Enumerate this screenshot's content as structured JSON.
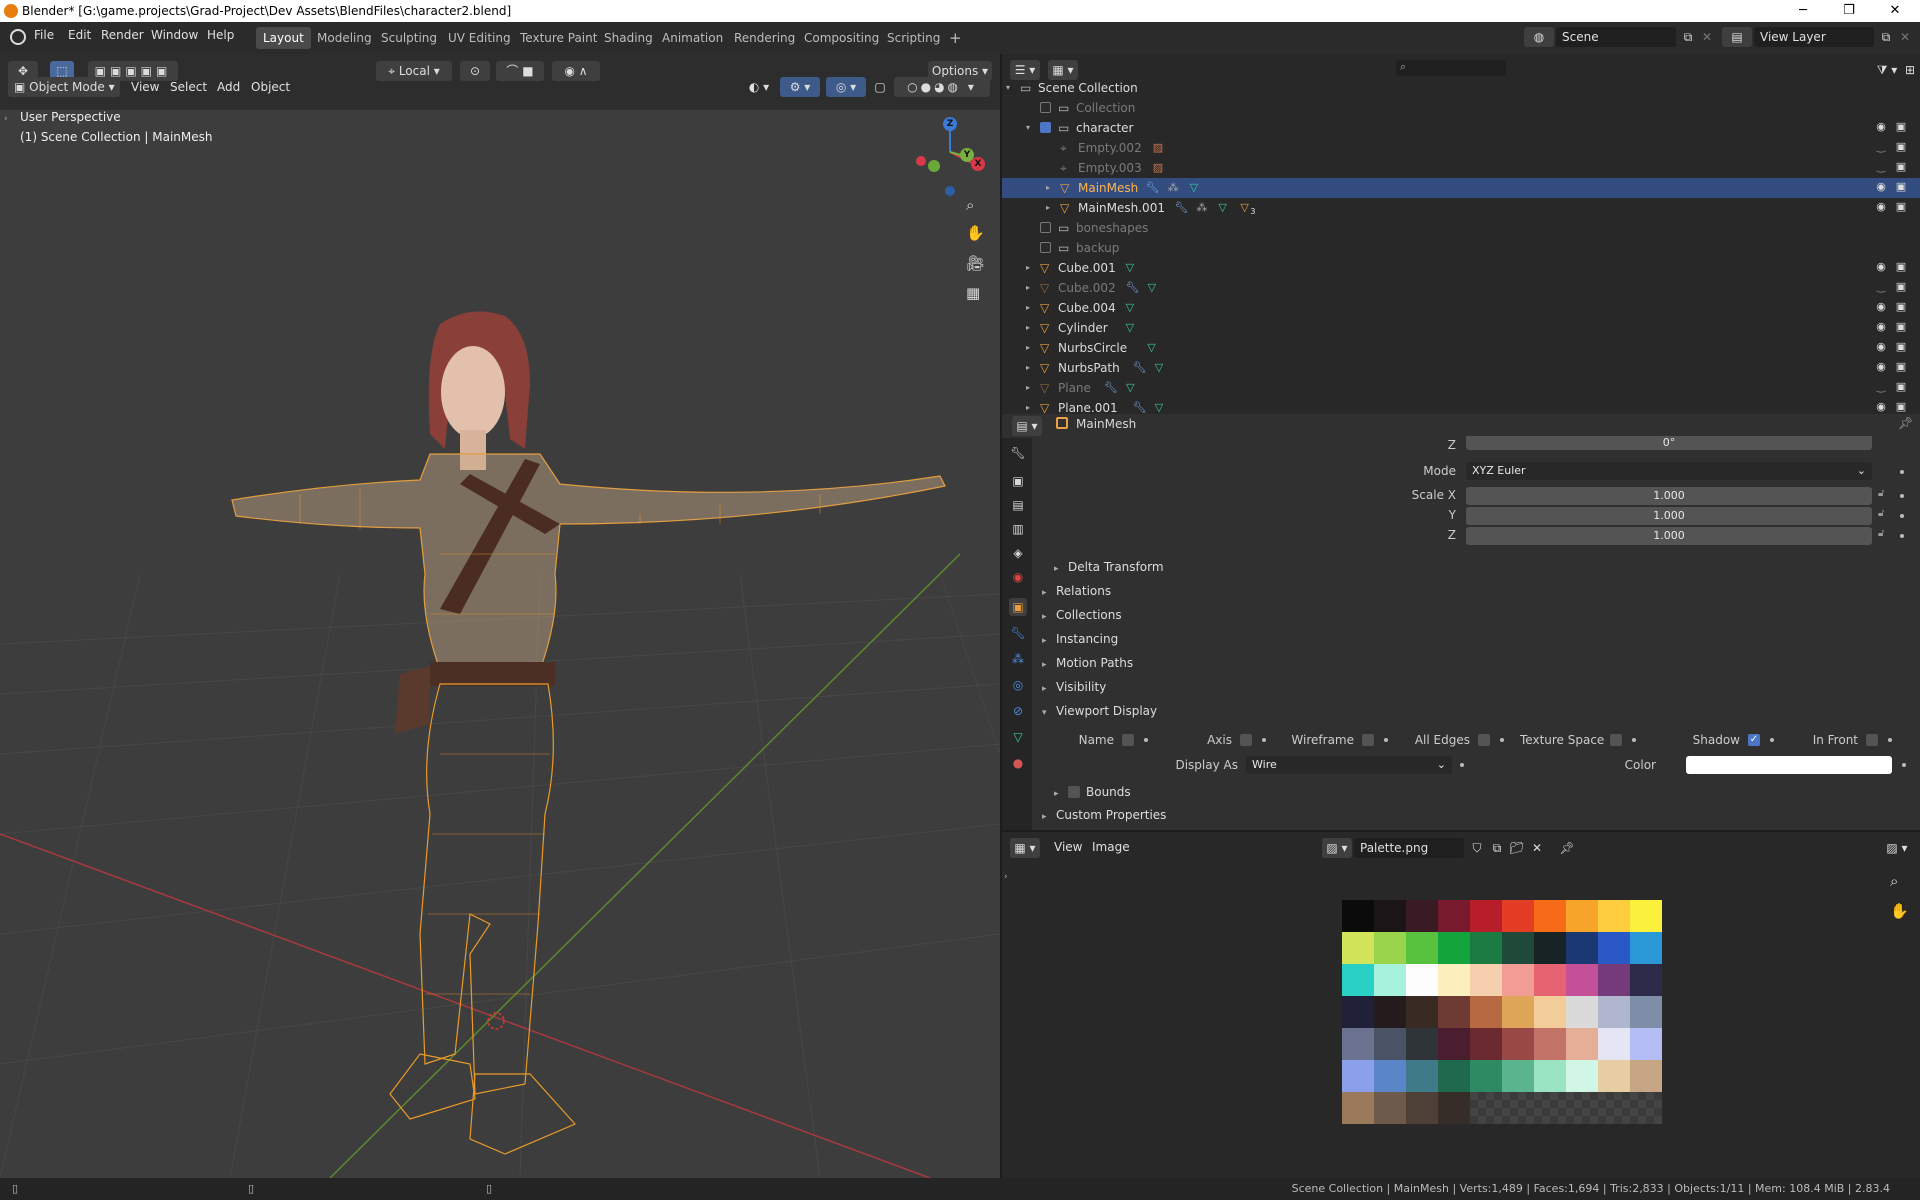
{
  "titlebar": {
    "title": "Blender* [G:\\game.projects\\Grad-Project\\Dev Assets\\BlendFiles\\character2.blend]",
    "minimize": "─",
    "restore": "❐",
    "close": "✕"
  },
  "menus": [
    "File",
    "Edit",
    "Render",
    "Window",
    "Help"
  ],
  "workspaces": [
    "Layout",
    "Modeling",
    "Sculpting",
    "UV Editing",
    "Texture Paint",
    "Shading",
    "Animation",
    "Rendering",
    "Compositing",
    "Scripting"
  ],
  "active_workspace": "Layout",
  "add_workspace": "+",
  "scene": {
    "label": "Scene",
    "view_layer": "View Layer"
  },
  "viewport": {
    "transform_orientation": "Local",
    "options_label": "Options",
    "mode": "Object Mode",
    "menus": [
      "View",
      "Select",
      "Add",
      "Object"
    ],
    "overlay_text": "User Perspective",
    "overlay_sub": "(1) Scene Collection | MainMesh",
    "gizmo": {
      "z": "Z",
      "y": "Y",
      "x": "X"
    }
  },
  "outliner": {
    "search_placeholder": "",
    "rows": [
      {
        "name": "Scene Collection",
        "indent": 0,
        "type": "collection",
        "state": "normal",
        "expanded": true
      },
      {
        "name": "Collection",
        "indent": 1,
        "type": "collection",
        "state": "disabled",
        "check": false
      },
      {
        "name": "character",
        "indent": 1,
        "type": "collection",
        "state": "normal",
        "check": true,
        "expanded": true,
        "vis": true
      },
      {
        "name": "Empty.002",
        "indent": 2,
        "type": "empty",
        "state": "disabled",
        "vis": false
      },
      {
        "name": "Empty.003",
        "indent": 2,
        "type": "empty",
        "state": "disabled",
        "vis": false
      },
      {
        "name": "MainMesh",
        "indent": 2,
        "type": "mesh",
        "state": "selected",
        "vis": true
      },
      {
        "name": "MainMesh.001",
        "indent": 2,
        "type": "mesh",
        "state": "normal",
        "vis": true,
        "badge": "3"
      },
      {
        "name": "boneshapes",
        "indent": 1,
        "type": "collection",
        "state": "disabled",
        "check": false
      },
      {
        "name": "backup",
        "indent": 1,
        "type": "collection",
        "state": "disabled",
        "check": false
      },
      {
        "name": "Cube.001",
        "indent": 1,
        "type": "mesh",
        "state": "normal",
        "vis": true
      },
      {
        "name": "Cube.002",
        "indent": 1,
        "type": "mesh",
        "state": "disabled",
        "vis": false
      },
      {
        "name": "Cube.004",
        "indent": 1,
        "type": "mesh",
        "state": "normal",
        "vis": true
      },
      {
        "name": "Cylinder",
        "indent": 1,
        "type": "mesh",
        "state": "normal",
        "vis": true
      },
      {
        "name": "NurbsCircle",
        "indent": 1,
        "type": "mesh",
        "state": "normal",
        "vis": true
      },
      {
        "name": "NurbsPath",
        "indent": 1,
        "type": "mesh",
        "state": "normal",
        "vis": true
      },
      {
        "name": "Plane",
        "indent": 1,
        "type": "mesh",
        "state": "disabled",
        "vis": false
      },
      {
        "name": "Plane.001",
        "indent": 1,
        "type": "mesh",
        "state": "normal",
        "vis": true
      }
    ]
  },
  "properties": {
    "object_name": "MainMesh",
    "rot_z_label": "Z",
    "rot_z_value": "0°",
    "mode_label": "Mode",
    "mode_value": "XYZ Euler",
    "scale_x_label": "Scale X",
    "scale_x": "1.000",
    "scale_y_label": "Y",
    "scale_y": "1.000",
    "scale_z_label": "Z",
    "scale_z": "1.000",
    "delta_transform": "Delta Transform",
    "sections": [
      "Relations",
      "Collections",
      "Instancing",
      "Motion Paths",
      "Visibility"
    ],
    "viewport_display": "Viewport Display",
    "vd_checks": [
      {
        "label": "Name",
        "on": false
      },
      {
        "label": "Axis",
        "on": false
      },
      {
        "label": "Wireframe",
        "on": false
      },
      {
        "label": "All Edges",
        "on": false
      },
      {
        "label": "Texture Space",
        "on": false
      },
      {
        "label": "Shadow",
        "on": true
      },
      {
        "label": "In Front",
        "on": false
      }
    ],
    "display_as_label": "Display As",
    "display_as_value": "Wire",
    "color_label": "Color",
    "color_value": "#ffffff",
    "bounds_label": "Bounds",
    "custom_properties": "Custom Properties"
  },
  "image_editor": {
    "menus": [
      "View",
      "Image"
    ],
    "image_name": "Palette.png",
    "palette": [
      "#0b0b0b",
      "#1b1518",
      "#3a1a24",
      "#781a2e",
      "#b81e2a",
      "#e33d26",
      "#f56b17",
      "#f6a52a",
      "#fecd3e",
      "#fbf13d",
      "#d2e45a",
      "#9ad44a",
      "#58c13d",
      "#13a43b",
      "#1b7b42",
      "#1f4a3a",
      "#172325",
      "#1b3872",
      "#2a58c6",
      "#2a98d6",
      "#2ad0c4",
      "#a6f2db",
      "#fdfdfd",
      "#fbefbd",
      "#f6cfae",
      "#f19c94",
      "#e66372",
      "#c4509a",
      "#743a7a",
      "#2e2a4a",
      "#202038",
      "#241c1c",
      "#3a2a24",
      "#6e3a34",
      "#b76a42",
      "#dfa65a",
      "#f2cd9a",
      "#dadada",
      "#b0b6ce",
      "#7e8ea8",
      "#6a7290",
      "#4a5266",
      "#2e3438",
      "#4a1e2e",
      "#6a2a30",
      "#9a4a46",
      "#c27266",
      "#e6ae96",
      "#e4e6f6",
      "#b4bcf6",
      "#8aa0ea",
      "#5a86c8",
      "#3e7a88",
      "#1f6a4e",
      "#2e8a62",
      "#5ab48e",
      "#9ae4c4",
      "#d2f6e6",
      "#e6cea2",
      "#c6a684",
      "#9a7a5a",
      "#6e5a4a",
      "#4e4036",
      "#362c28"
    ]
  },
  "statusbar": {
    "text": "Scene Collection | MainMesh | Verts:1,489 | Faces:1,694 | Tris:2,833 | Objects:1/11 | Mem: 108.4 MiB | 2.83.4"
  }
}
